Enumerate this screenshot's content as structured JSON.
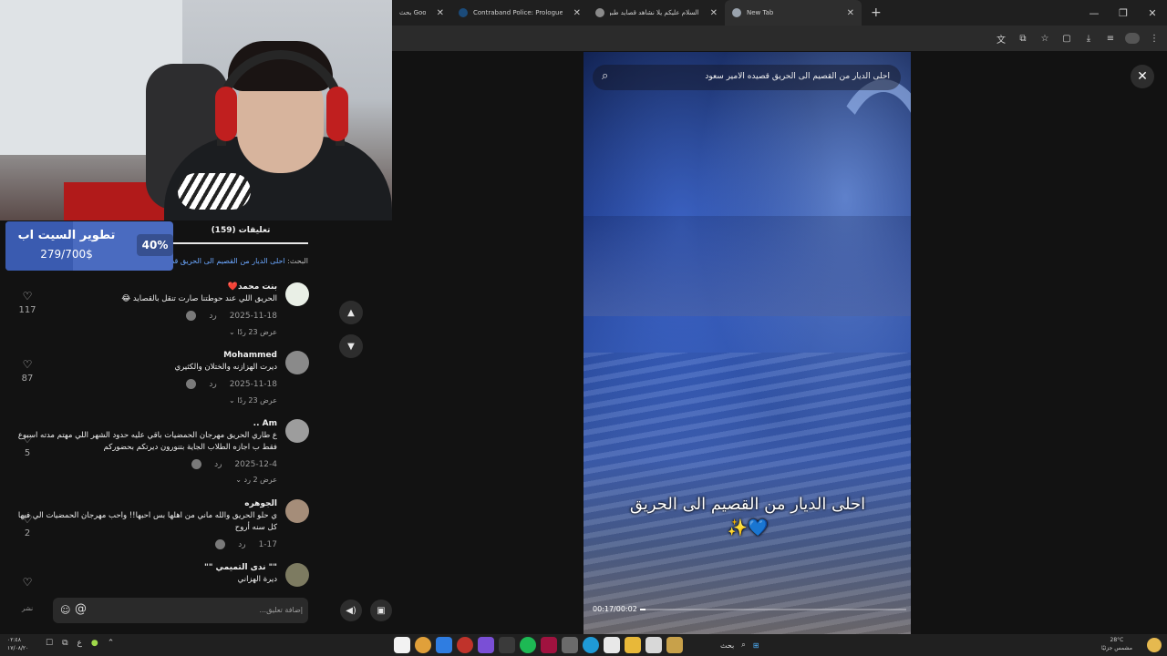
{
  "browser": {
    "tabs": [
      {
        "label": "بحث Google -",
        "icon": "google-icon"
      },
      {
        "label": "Contraband Police: Prologue على Steam",
        "icon": "steam-icon"
      },
      {
        "label": "السلام عليكم يلا نشاهد قصايد طبوريات",
        "icon": "globe-icon"
      },
      {
        "label": "New Tab",
        "icon": "chrome-icon"
      }
    ],
    "new_tab_label": "+",
    "window_controls": {
      "minimize": "—",
      "restore": "❐",
      "close": "✕"
    },
    "toolbar_icons": [
      "translate-icon",
      "screencast-icon",
      "star-icon",
      "extensions-icon",
      "download-icon",
      "media-icon",
      "profile-icon",
      "menu-icon"
    ]
  },
  "goal": {
    "title": "تطوير السيت اب",
    "amount": "279/700$",
    "percent_label": "40%",
    "progress": 0.4
  },
  "comments_panel": {
    "count_label": "(159) تعليقات",
    "search_prefix": "البحث:",
    "search_query": "احلى الديار من القصيم الى الحريق قصيده الامير سعود",
    "comments": [
      {
        "user": "بنت محمد❤️",
        "text": "الحريق اللي عند حوطتنا صارت تنقل بالقصايد 😂",
        "date": "2025-11-18",
        "reply": "رد",
        "replies": "عرض 23 ردًا",
        "likes": "117"
      },
      {
        "user": "Mohammed",
        "text": "ديرت الهزازنه والختلان والكثيري",
        "date": "2025-11-18",
        "reply": "رد",
        "replies": "عرض 23 ردًا",
        "likes": "87"
      },
      {
        "user": "Am ..",
        "text": "ع طاري الحريق مهرجان الحمضيات باقي عليه حدود الشهر اللي مهتم مدته اسبوع فقط ب اجازه الطلاب الجاية بتنورون ديرتكم بحضوركم",
        "date": "2025-12-4",
        "reply": "رد",
        "replies": "عرض 2 رد",
        "likes": "5"
      },
      {
        "user": "الجوهره",
        "text": "ي حلو الحريق والله ماني من اهلها بس احبها!! واحب مهرجان الحمضيات الي فيها كل سنه أروح",
        "date": "1-17",
        "reply": "رد",
        "replies": "",
        "likes": "2"
      },
      {
        "user": "\"\" ندى التميمي \"\"",
        "text": "ديرة الهزاني",
        "date": "",
        "reply": "",
        "replies": "",
        "likes": ""
      }
    ],
    "input_placeholder": "إضافة تعليق...",
    "side_label": "نشر"
  },
  "video": {
    "search_text": "احلى الديار من القصيم الى الحريق قصيده الامير سعود",
    "caption": "احلى الديار من القصيم الى الحريق💙✨",
    "time_label": "00:17/00:02",
    "progress": 0.02
  },
  "taskbar": {
    "left_time": "٠٢:٤٨",
    "left_date": "١٧/٠٨/٢٠",
    "lang": "ع",
    "search_label": "بحث",
    "weather_temp": "28°C",
    "weather_text": "مشمس جزئيًا"
  }
}
